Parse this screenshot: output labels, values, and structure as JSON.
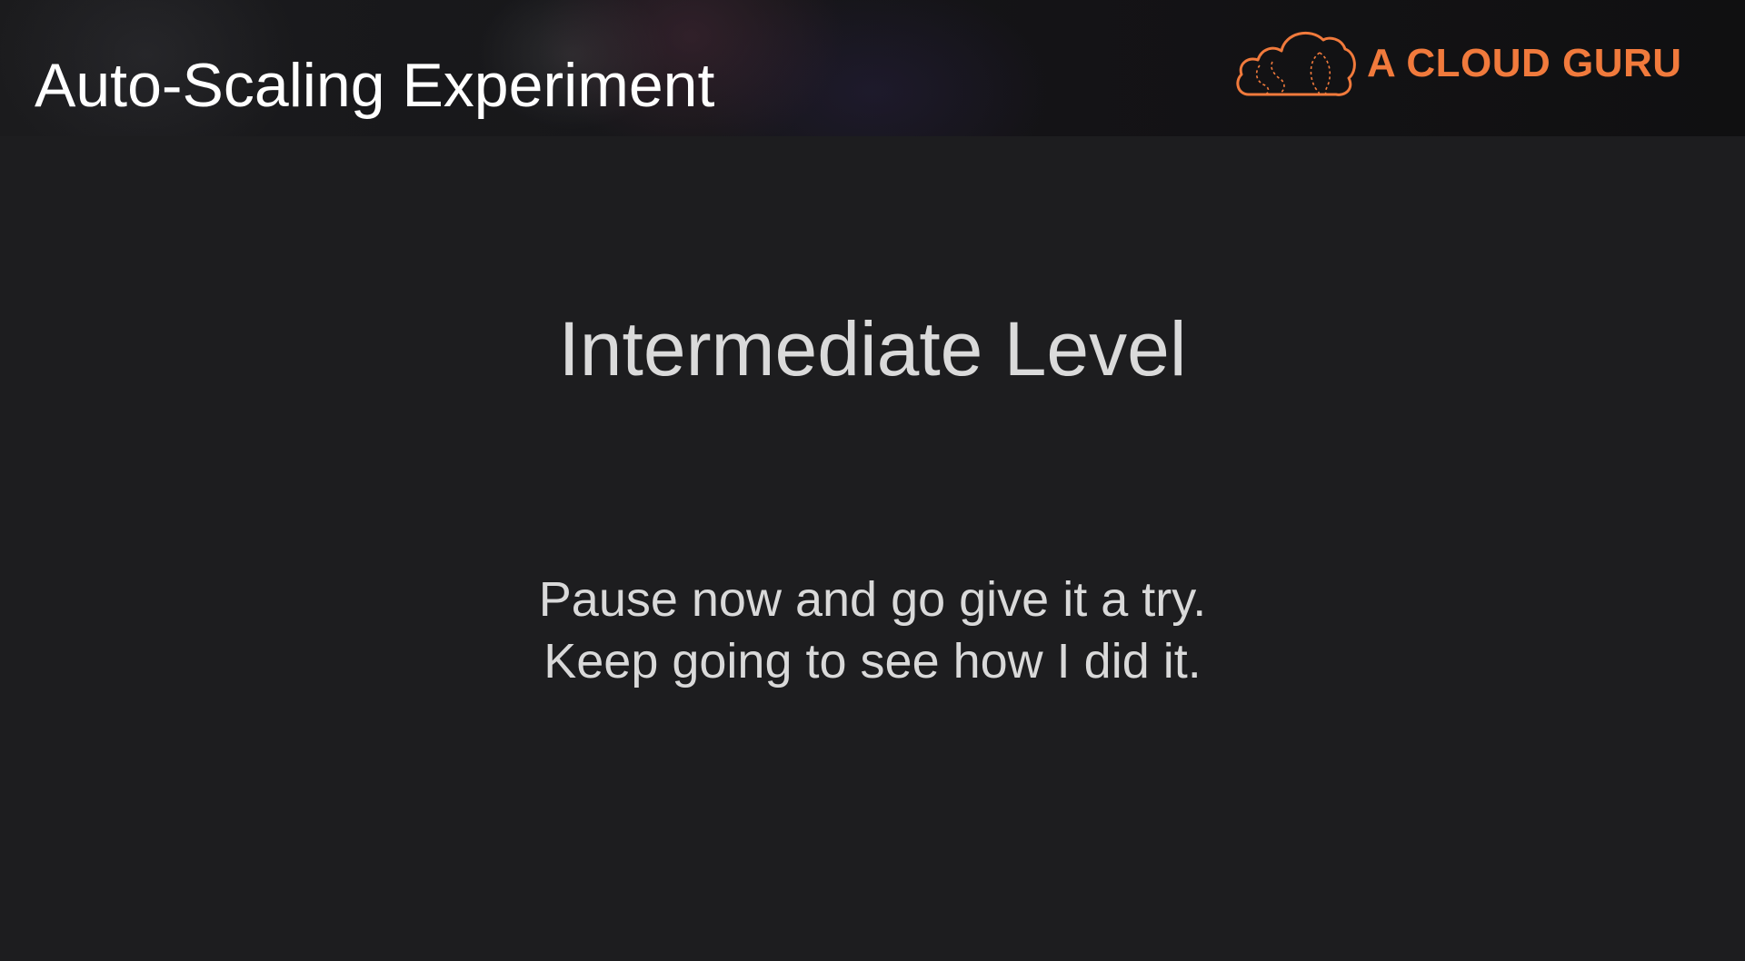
{
  "header": {
    "title": "Auto-Scaling Experiment",
    "logo": {
      "text": "A CLOUD GURU",
      "icon": "cloud-icon",
      "color": "#f17a3c"
    }
  },
  "main": {
    "heading": "Intermediate Level",
    "instructions": [
      "Pause now and go give it a try.",
      "Keep going to see how I did it."
    ]
  },
  "colors": {
    "background": "#1d1d1f",
    "header_background": "#121213",
    "title_text": "#ffffff",
    "body_text": "#dadada",
    "brand_accent": "#f17a3c"
  }
}
